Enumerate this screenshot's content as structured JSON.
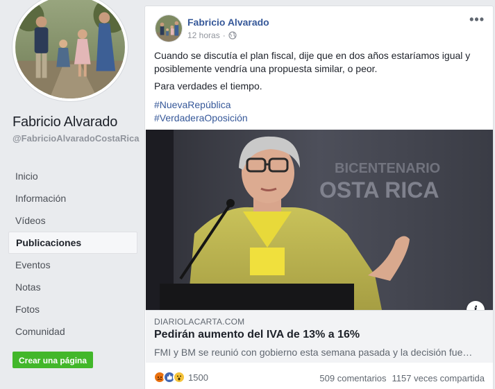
{
  "sidebar": {
    "page_name": "Fabricio Alvarado",
    "handle": "@FabricioAlvaradoCostaRica",
    "nav": [
      "Inicio",
      "Información",
      "Vídeos",
      "Publicaciones",
      "Eventos",
      "Notas",
      "Fotos",
      "Comunidad"
    ],
    "active_item": "Publicaciones",
    "create_page_label": "Crear una página"
  },
  "post": {
    "author": "Fabricio Alvarado",
    "time": "12 horas",
    "separator": "·",
    "text_line1": "Cuando se discutía el plan fiscal, dije que en dos años estaríamos igual y posiblemente vendría una propuesta similar, o peor.",
    "text_line2": "Para verdades el tiempo.",
    "hashtags": [
      "#NuevaRepública",
      "#VerdaderaOposición"
    ],
    "link": {
      "domain": "DIARIOLACARTA.COM",
      "title": "Pedirán aumento del IVA de 13% a 16%",
      "description": "FMI y BM se reunió con gobierno esta semana pasada y la decisión fue…",
      "image_backdrop_text": [
        "BICENTENARIO",
        "OSTA RICA"
      ]
    },
    "reactions_count": "1500",
    "comments": "509 comentarios",
    "shares": "1157 veces compartida"
  },
  "colors": {
    "link_blue": "#365899",
    "green_button": "#42b72a",
    "background": "#e9ebee"
  }
}
